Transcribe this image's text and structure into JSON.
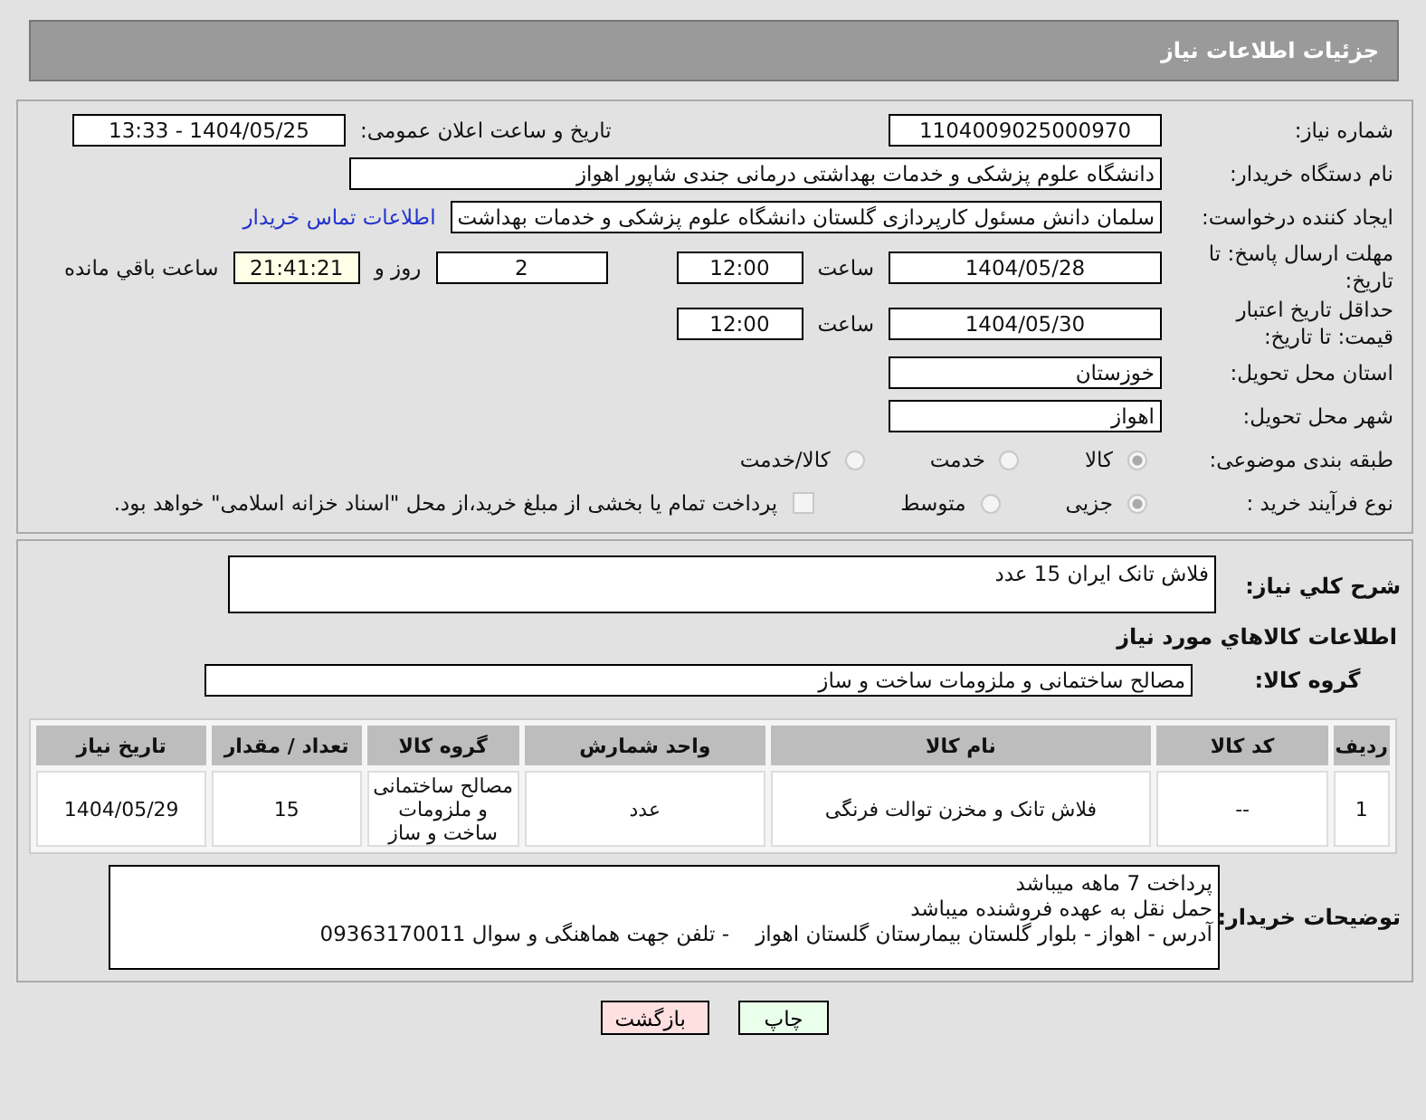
{
  "header": {
    "title": "جزئیات اطلاعات نیاز"
  },
  "need_number": {
    "label": "شماره نیاز:",
    "value": "1104009025000970"
  },
  "announce": {
    "label": "تاریخ و ساعت اعلان عمومی:",
    "value": "1404/05/25 - 13:33"
  },
  "buyer": {
    "label": "نام دستگاه خریدار:",
    "value": "دانشگاه علوم پزشکی و خدمات بهداشتی درمانی جندی شاپور اهواز"
  },
  "requester": {
    "label": "ایجاد کننده درخواست:",
    "value": "سلمان دانش مسئول کارپردازی گلستان دانشگاه علوم پزشکی و خدمات بهداشت",
    "link": "اطلاعات تماس خریدار"
  },
  "deadline": {
    "label": "مهلت ارسال پاسخ: تا تاریخ:",
    "date": "1404/05/28",
    "time_label": "ساعت",
    "time": "12:00",
    "days": "2",
    "days_label": "روز و",
    "remaining": "21:41:21",
    "remaining_label": "ساعت باقي مانده"
  },
  "validity": {
    "label": "حداقل تاریخ اعتبار قیمت: تا تاریخ:",
    "date": "1404/05/30",
    "time_label": "ساعت",
    "time": "12:00"
  },
  "province": {
    "label": "استان محل تحویل:",
    "value": "خوزستان"
  },
  "city": {
    "label": "شهر محل تحویل:",
    "value": "اهواز"
  },
  "category": {
    "label": "طبقه بندی موضوعی:",
    "options": [
      {
        "label": "کالا",
        "selected": true
      },
      {
        "label": "خدمت",
        "selected": false
      },
      {
        "label": "کالا/خدمت",
        "selected": false
      }
    ]
  },
  "process": {
    "label": "نوع فرآیند خرید :",
    "options": [
      {
        "label": "جزیی",
        "selected": true
      },
      {
        "label": "متوسط",
        "selected": false
      }
    ],
    "treasury": {
      "checked": false,
      "text": "پرداخت تمام یا بخشی از مبلغ خرید،از محل \"اسناد خزانه اسلامی\" خواهد بود."
    }
  },
  "description": {
    "label": "شرح کلي نياز:",
    "value": "فلاش تانک ایران  15 عدد"
  },
  "goods_title": "اطلاعات کالاهاي مورد نياز",
  "goods_group": {
    "label": "گروه کالا:",
    "value": "مصالح ساختمانی و ملزومات ساخت و ساز"
  },
  "table": {
    "columns": [
      "رديف",
      "کد کالا",
      "نام کالا",
      "واحد شمارش",
      "گروه کالا",
      "تعداد / مقدار",
      "تاریخ نیاز"
    ],
    "rows": [
      [
        "1",
        "--",
        "فلاش تانک و مخزن توالت فرنگی",
        "عدد",
        "مصالح ساختمانی و ملزومات ساخت و ساز",
        "15",
        "1404/05/29"
      ]
    ]
  },
  "notes": {
    "label": "توضیحات خریدار:",
    "lines": [
      "پرداخت 7 ماهه میباشد",
      "حمل نقل به عهده فروشنده میباشد",
      "آدرس - اهواز - بلوار گلستان بیمارستان گلستان اهواز    - تلفن جهت هماهنگی و سوال 09363170011"
    ]
  },
  "buttons": [
    {
      "kind": "print",
      "label": "چاپ"
    },
    {
      "kind": "back",
      "label": "بازگشت"
    }
  ]
}
